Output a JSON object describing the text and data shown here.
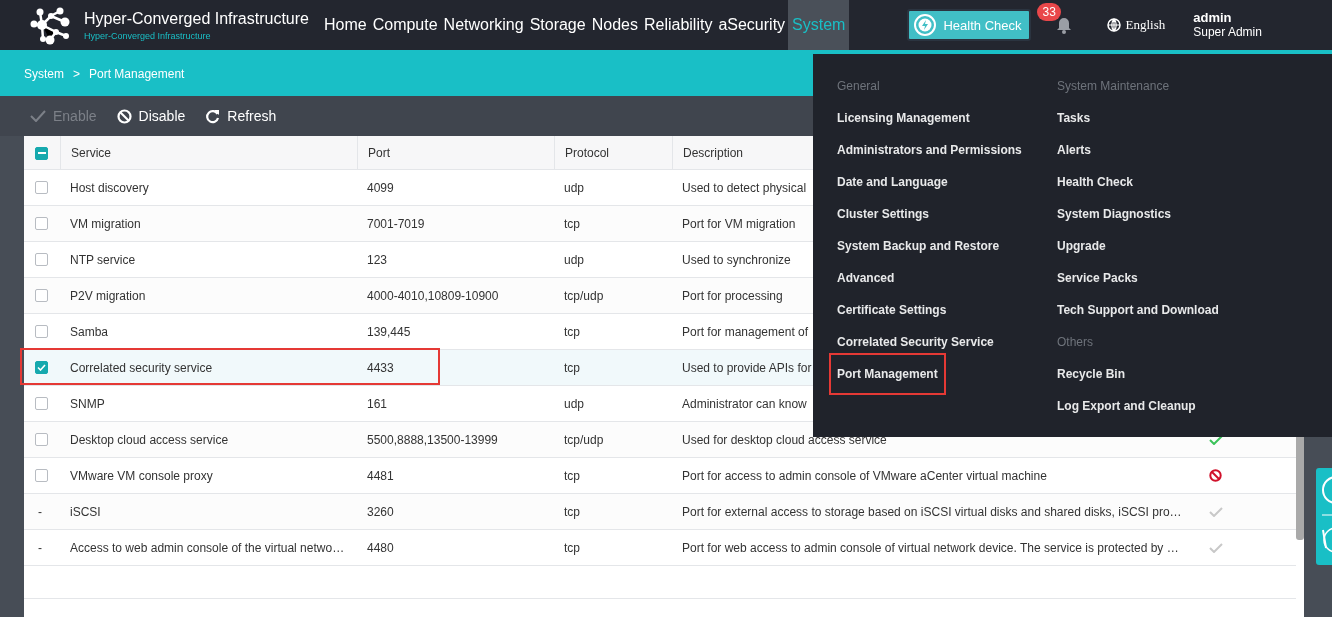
{
  "header": {
    "title": "Hyper-Converged Infrastructure",
    "subtitle": "Hyper-Converged Infrastructure",
    "nav": [
      {
        "label": "Home",
        "selected": false
      },
      {
        "label": "Compute",
        "selected": false
      },
      {
        "label": "Networking",
        "selected": false
      },
      {
        "label": "Storage",
        "selected": false
      },
      {
        "label": "Nodes",
        "selected": false
      },
      {
        "label": "Reliability",
        "selected": false
      },
      {
        "label": "aSecurity",
        "selected": false
      },
      {
        "label": "System",
        "selected": true
      }
    ],
    "health_check": "Health Check",
    "notifications": "33",
    "language": "English",
    "user": {
      "name": "admin",
      "role": "Super Admin"
    }
  },
  "breadcrumb": [
    "System",
    ">",
    "Port Management"
  ],
  "toolbar": [
    {
      "kind": "enable",
      "label": "Enable",
      "disabled": true
    },
    {
      "kind": "disable",
      "label": "Disable",
      "disabled": false
    },
    {
      "kind": "refresh",
      "label": "Refresh",
      "disabled": false
    }
  ],
  "table": {
    "header_checkbox_indeterminate": true,
    "columns": [
      "Service",
      "Port",
      "Protocol",
      "Description"
    ],
    "rows": [
      {
        "kind": "checkbox",
        "checked": false,
        "annotated": false,
        "service": "Host discovery",
        "port": "4099",
        "protocol": "udp",
        "description": "Used to detect physical"
      },
      {
        "kind": "checkbox",
        "checked": false,
        "annotated": false,
        "service": "VM migration",
        "port": "7001-7019",
        "protocol": "tcp",
        "description": "Port for VM migration"
      },
      {
        "kind": "checkbox",
        "checked": false,
        "annotated": false,
        "service": "NTP service",
        "port": "123",
        "protocol": "udp",
        "description": "Used to synchronize"
      },
      {
        "kind": "checkbox",
        "checked": false,
        "annotated": false,
        "service": "P2V migration",
        "port": "4000-4010,10809-10900",
        "protocol": "tcp/udp",
        "description": "Port for processing"
      },
      {
        "kind": "checkbox",
        "checked": false,
        "annotated": false,
        "service": "Samba",
        "port": "139,445",
        "protocol": "tcp",
        "description": "Port for management of"
      },
      {
        "kind": "checkbox",
        "checked": true,
        "annotated": true,
        "service": "Correlated security service",
        "port": "4433",
        "protocol": "tcp",
        "description": "Used to provide APIs for"
      },
      {
        "kind": "checkbox",
        "checked": false,
        "annotated": false,
        "service": "SNMP",
        "port": "161",
        "protocol": "udp",
        "description": "Administrator can know"
      },
      {
        "kind": "checkbox",
        "checked": false,
        "annotated": false,
        "service": "Desktop cloud access service",
        "port": "5500,8888,13500-13999",
        "protocol": "tcp/udp",
        "description": "Used for desktop cloud access service",
        "enabled": true
      },
      {
        "kind": "checkbox",
        "checked": false,
        "annotated": false,
        "service": "VMware VM console proxy",
        "port": "4481",
        "protocol": "tcp",
        "description": "Port for access to admin console of VMware aCenter virtual machine",
        "enabled": false
      },
      {
        "kind": "fixed",
        "dash": "-",
        "service": "iSCSI",
        "port": "3260",
        "protocol": "tcp",
        "description": "Port for external access to storage based on iSCSI virtual disks and shared disks, iSCSI pro…",
        "enabled": true
      },
      {
        "kind": "fixed",
        "dash": "-",
        "service": "Access to web admin console of the virtual netwo…",
        "port": "4480",
        "protocol": "tcp",
        "description": "Port for web access to admin console of virtual network device. The service is protected by …",
        "enabled": true
      }
    ]
  },
  "system_menu": {
    "columns": [
      [
        {
          "heading": "General",
          "items": [
            {
              "label": "Licensing Management",
              "annotated": false
            },
            {
              "label": "Administrators and Permissions",
              "annotated": false
            },
            {
              "label": "Date and Language",
              "annotated": false
            },
            {
              "label": "Cluster Settings",
              "annotated": false
            },
            {
              "label": "System Backup and Restore",
              "annotated": false
            },
            {
              "label": "Advanced",
              "annotated": false
            },
            {
              "label": "Certificate Settings",
              "annotated": false
            },
            {
              "label": "Correlated Security Service",
              "annotated": false
            },
            {
              "label": "Port Management",
              "annotated": true
            }
          ]
        }
      ],
      [
        {
          "heading": "System Maintenance",
          "items": [
            {
              "label": "Tasks",
              "annotated": false
            },
            {
              "label": "Alerts",
              "annotated": false
            },
            {
              "label": "Health Check",
              "annotated": false
            },
            {
              "label": "System Diagnostics",
              "annotated": false
            },
            {
              "label": "Upgrade",
              "annotated": false
            },
            {
              "label": "Service Packs",
              "annotated": false
            },
            {
              "label": "Tech Support and Download",
              "annotated": false
            }
          ]
        },
        {
          "heading": "Others",
          "items": [
            {
              "label": "Recycle Bin",
              "annotated": false
            },
            {
              "label": "Log Export and Cleanup",
              "annotated": false
            }
          ]
        }
      ]
    ]
  }
}
